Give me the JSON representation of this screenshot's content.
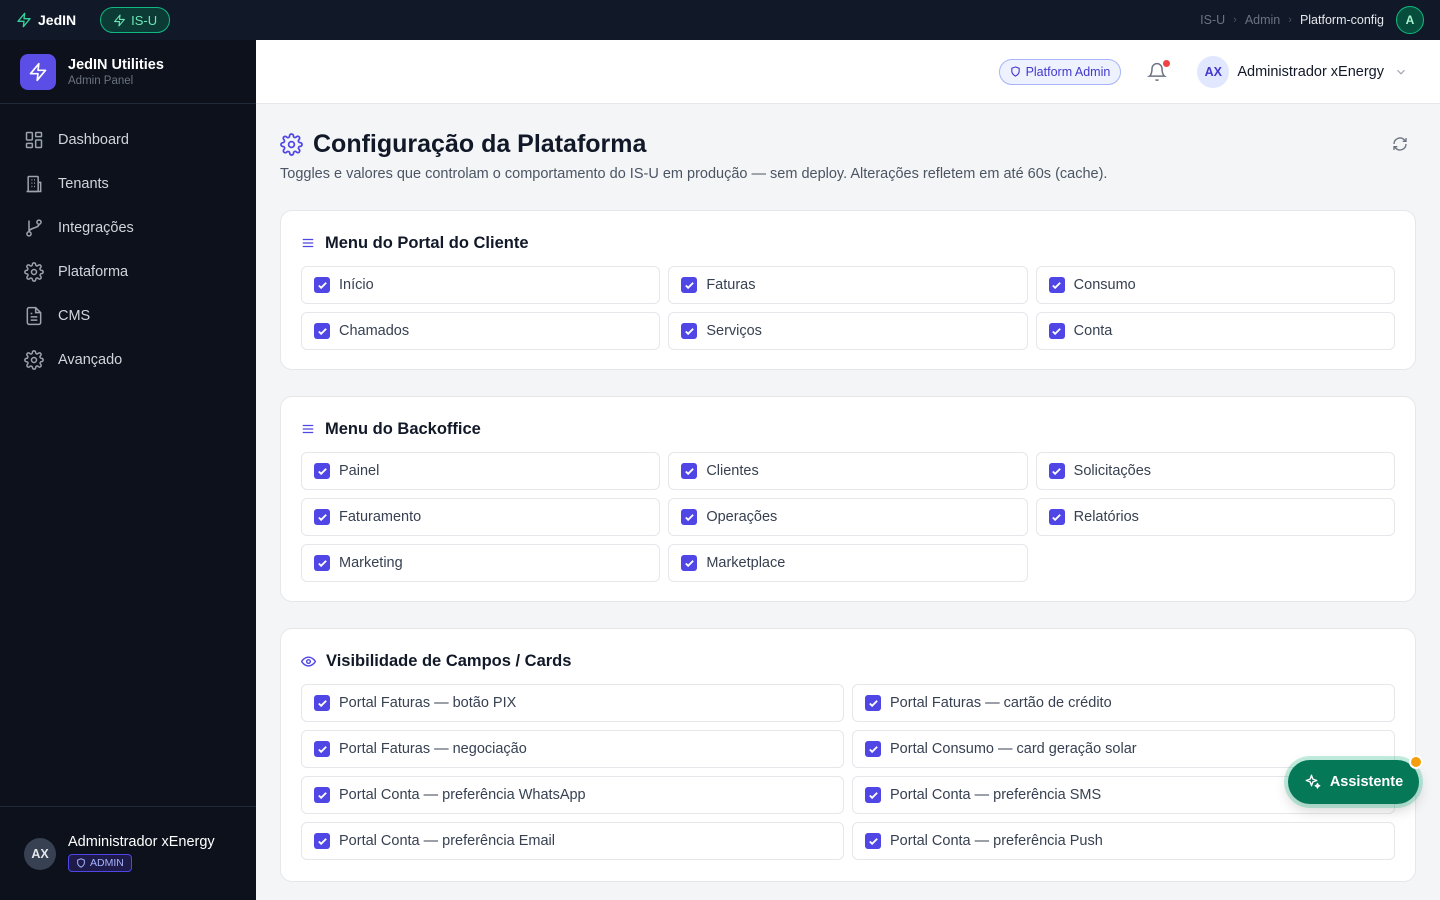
{
  "topbar": {
    "app_name": "JedIN",
    "env_label": "IS-U",
    "breadcrumb": [
      "IS-U",
      "Admin",
      "Platform-config"
    ],
    "avatar": "A"
  },
  "sidebar": {
    "brand_title": "JedIN Utilities",
    "brand_subtitle": "Admin Panel",
    "items": [
      {
        "label": "Dashboard",
        "icon": "grid-icon"
      },
      {
        "label": "Tenants",
        "icon": "building-icon"
      },
      {
        "label": "Integrações",
        "icon": "git-branch-icon"
      },
      {
        "label": "Plataforma",
        "icon": "gear-icon"
      },
      {
        "label": "CMS",
        "icon": "document-icon"
      },
      {
        "label": "Avançado",
        "icon": "gear-icon"
      }
    ],
    "user": {
      "initials": "AX",
      "name": "Administrador xEnergy",
      "badge": "ADMIN"
    }
  },
  "header": {
    "role_label": "Platform Admin",
    "user_initials": "AX",
    "user_name": "Administrador xEnergy"
  },
  "page": {
    "title": "Configuração da Plataforma",
    "description": "Toggles e valores que controlam o comportamento do IS-U em produção — sem deploy. Alterações refletem em até 60s (cache)."
  },
  "sections": {
    "portal_menu": {
      "title": "Menu do Portal do Cliente",
      "options": [
        {
          "label": "Início",
          "checked": true
        },
        {
          "label": "Faturas",
          "checked": true
        },
        {
          "label": "Consumo",
          "checked": true
        },
        {
          "label": "Chamados",
          "checked": true
        },
        {
          "label": "Serviços",
          "checked": true
        },
        {
          "label": "Conta",
          "checked": true
        }
      ]
    },
    "backoffice_menu": {
      "title": "Menu do Backoffice",
      "options": [
        {
          "label": "Painel",
          "checked": true
        },
        {
          "label": "Clientes",
          "checked": true
        },
        {
          "label": "Solicitações",
          "checked": true
        },
        {
          "label": "Faturamento",
          "checked": true
        },
        {
          "label": "Operações",
          "checked": true
        },
        {
          "label": "Relatórios",
          "checked": true
        },
        {
          "label": "Marketing",
          "checked": true
        },
        {
          "label": "Marketplace",
          "checked": true
        }
      ]
    },
    "visibility": {
      "title": "Visibilidade de Campos / Cards",
      "options": [
        {
          "label": "Portal Faturas — botão PIX",
          "checked": true
        },
        {
          "label": "Portal Faturas — cartão de crédito",
          "checked": true
        },
        {
          "label": "Portal Faturas — negociação",
          "checked": true
        },
        {
          "label": "Portal Consumo — card geração solar",
          "checked": true
        },
        {
          "label": "Portal Conta — preferência WhatsApp",
          "checked": true
        },
        {
          "label": "Portal Conta — preferência SMS",
          "checked": true
        },
        {
          "label": "Portal Conta — preferência Email",
          "checked": true
        },
        {
          "label": "Portal Conta — preferência Push",
          "checked": true
        }
      ]
    }
  },
  "assistant": {
    "label": "Assistente"
  },
  "colors": {
    "accent": "#4f46e5",
    "sidebar_bg": "#0c111b",
    "assistant_bg": "#047857"
  }
}
